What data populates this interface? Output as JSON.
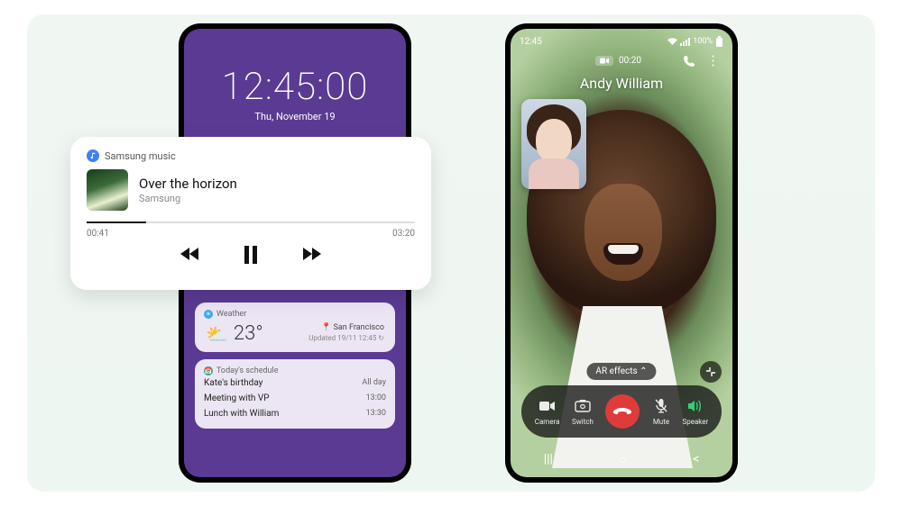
{
  "left_phone": {
    "clock_time": "12:45:00",
    "clock_date": "Thu, November 19",
    "weather": {
      "header": "Weather",
      "temp": "23°",
      "location": "San Francisco",
      "updated": "Updated 19/11 12:45"
    },
    "schedule": {
      "header": "Today's schedule",
      "items": [
        {
          "title": "Kate's birthday",
          "time": "All day"
        },
        {
          "title": "Meeting with VP",
          "time": "13:00"
        },
        {
          "title": "Lunch with William",
          "time": "13:30"
        }
      ]
    }
  },
  "music": {
    "app_name": "Samsung music",
    "track_title": "Over the horizon",
    "track_artist": "Samsung",
    "elapsed": "00:41",
    "total": "03:20"
  },
  "right_phone": {
    "status_time": "12:45",
    "battery_text": "100%",
    "call_duration": "00:20",
    "caller_name": "Andy William",
    "ar_label": "AR effects ⌃",
    "buttons": {
      "camera": "Camera",
      "switch": "Switch",
      "mute": "Mute",
      "speaker": "Speaker"
    }
  }
}
